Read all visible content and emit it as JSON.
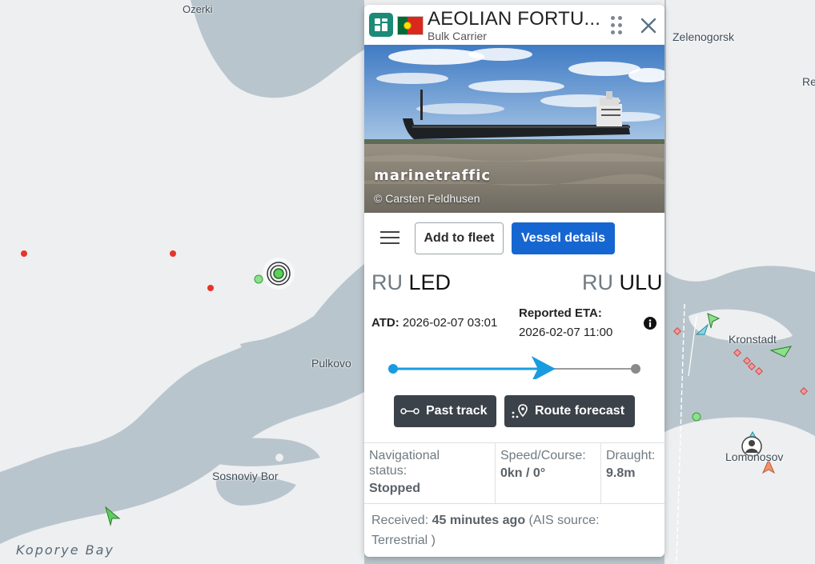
{
  "map": {
    "places": {
      "ozerki": "Ozerki",
      "zelenogorsk": "Zelenogorsk",
      "re": "Re",
      "pulkovo": "Pulkovo",
      "kronstadt": "Kronstadt",
      "sosnoviy_bor": "Sosnoviy Bor",
      "lomonosov": "Lomonosov",
      "koporye_bay": "Koporye Bay"
    },
    "colors": {
      "water": "#b9c5cc",
      "land": "#edeff1",
      "vessel_stopped": "#e8322b",
      "vessel_moored": "#5ccf5c"
    }
  },
  "vessel_card": {
    "name": "AEOLIAN FORTU...",
    "type": "Bulk Carrier",
    "type_icon": "bulk-carrier-icon",
    "flag": "portugal-flag",
    "photo": {
      "brand": "marinetraffic",
      "credit": "© Carsten Feldhusen"
    },
    "buttons": {
      "add_to_fleet": "Add to fleet",
      "vessel_details": "Vessel details"
    },
    "departure": {
      "country": "RU",
      "port": "LED"
    },
    "arrival": {
      "country": "RU",
      "port": "ULU"
    },
    "atd_label": "ATD:",
    "atd_value": "2026-02-07 03:01",
    "eta_label": "Reported ETA:",
    "eta_value": "2026-02-07 11:00",
    "route_progress": 0.6,
    "past_track_label": "Past track",
    "route_forecast_label": "Route forecast",
    "status": {
      "nav_label": "Navigational status:",
      "nav_value": "Stopped",
      "speed_label": "Speed/Course:",
      "speed_value": "0kn / 0°",
      "draught_label": "Draught:",
      "draught_value": "9.8m"
    },
    "received_label": "Received:",
    "received_value": "45 minutes ago",
    "ais_source": "(AIS source: Terrestrial )",
    "colors": {
      "primary": "#1666d2",
      "route": "#1a9be0",
      "dark_button": "#3b4249"
    }
  }
}
